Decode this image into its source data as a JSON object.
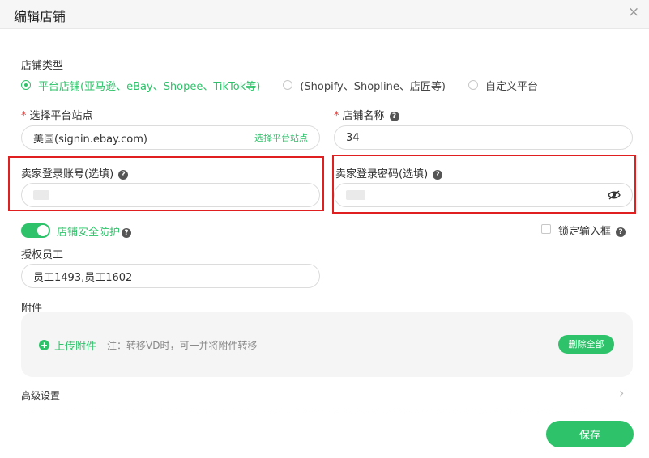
{
  "dialog": {
    "title": "编辑店铺",
    "close_icon": "×"
  },
  "store_type": {
    "label": "店铺类型",
    "options": [
      {
        "label": "平台店铺(亚马逊、eBay、Shopee、TikTok等)",
        "checked": true
      },
      {
        "label": "(Shopify、Shopline、店匠等)",
        "checked": false
      },
      {
        "label": "自定义平台",
        "checked": false
      }
    ]
  },
  "platform_site": {
    "label": "选择平台站点",
    "value": "美国(signin.ebay.com)",
    "link": "选择平台站点"
  },
  "store_name": {
    "label": "店铺名称",
    "value": "34"
  },
  "seller_account": {
    "label": "卖家登录账号(选填)"
  },
  "seller_password": {
    "label": "卖家登录密码(选填)"
  },
  "security": {
    "label": "店铺安全防护",
    "enabled": true
  },
  "lock_input": {
    "label": "锁定输入框",
    "checked": false
  },
  "staff": {
    "label": "授权员工",
    "value": "员工1493,员工1602"
  },
  "attachments": {
    "label": "附件",
    "upload_label": "上传附件",
    "note": "注：转移VD时，可一并将附件转移",
    "delete_all": "删除全部"
  },
  "advanced": {
    "label": "高级设置"
  },
  "save_label": "保存",
  "colors": {
    "accent": "#2ec36a",
    "highlight_border": "#e02020"
  },
  "icons": {
    "help": "?",
    "plus": "+",
    "chevron": "›"
  }
}
